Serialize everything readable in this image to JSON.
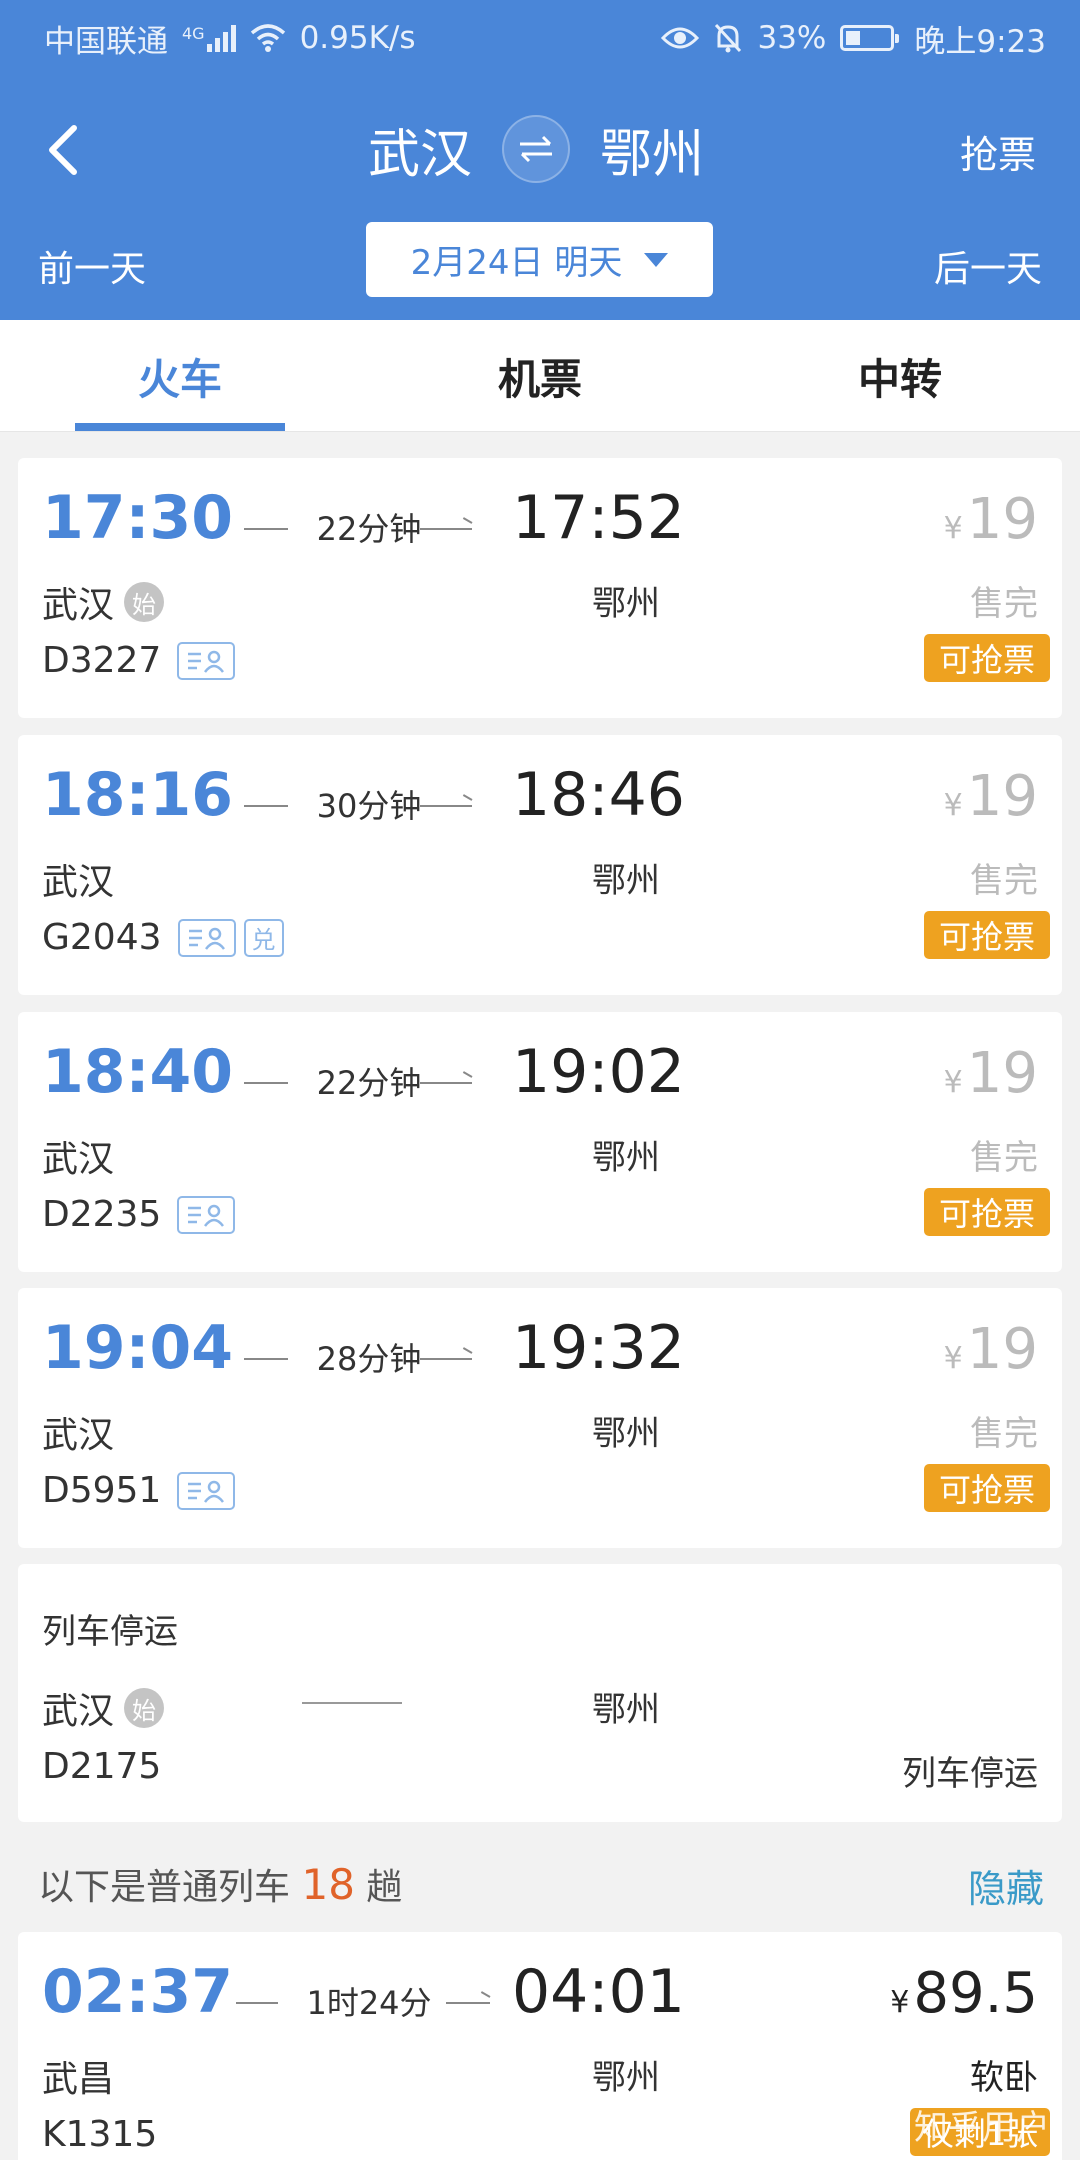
{
  "status_bar": {
    "carrier": "中国联通",
    "network": "4G",
    "speed": "0.95K/s",
    "battery": "33%",
    "battery_level": 0.33,
    "time": "晚上9:23"
  },
  "header": {
    "from": "武汉",
    "to": "鄂州",
    "grab_ticket": "抢票",
    "prev_day": "前一天",
    "next_day": "后一天",
    "date": "2月24日 明天"
  },
  "tabs": [
    "火车",
    "机票",
    "中转"
  ],
  "trains": [
    {
      "dep": "17:30",
      "duration": "22分钟",
      "arr": "17:52",
      "price": "19",
      "from": "武汉",
      "from_badge": "始",
      "to": "鄂州",
      "status": "售完",
      "train_no": "D3227",
      "badge": "可抢票"
    },
    {
      "dep": "18:16",
      "duration": "30分钟",
      "arr": "18:46",
      "price": "19",
      "from": "武汉",
      "to": "鄂州",
      "status": "售完",
      "train_no": "G2043",
      "extra": "兑",
      "badge": "可抢票"
    },
    {
      "dep": "18:40",
      "duration": "22分钟",
      "arr": "19:02",
      "price": "19",
      "from": "武汉",
      "to": "鄂州",
      "status": "售完",
      "train_no": "D2235",
      "badge": "可抢票"
    },
    {
      "dep": "19:04",
      "duration": "28分钟",
      "arr": "19:32",
      "price": "19",
      "from": "武汉",
      "to": "鄂州",
      "status": "售完",
      "train_no": "D5951",
      "badge": "可抢票"
    }
  ],
  "suspended": {
    "title": "列车停运",
    "from": "武汉",
    "from_badge": "始",
    "to": "鄂州",
    "train_no": "D2175",
    "status": "列车停运"
  },
  "section": {
    "prefix": "以下是普通列车",
    "count": "18",
    "suffix": "趟",
    "hide": "隐藏"
  },
  "normal_train": {
    "dep": "02:37",
    "duration": "1时24分",
    "arr": "04:01",
    "yen": "¥",
    "price": "89.5",
    "from": "武昌",
    "to": "鄂州",
    "seat": "软卧",
    "train_no": "K1315",
    "badge_partial": "仅剩1张"
  },
  "watermark": "知乎用户",
  "currency": "¥",
  "colors": {
    "primary": "#4a86d8",
    "grab": "#eea220",
    "count": "#e0632a",
    "hide": "#3a9ac8"
  }
}
